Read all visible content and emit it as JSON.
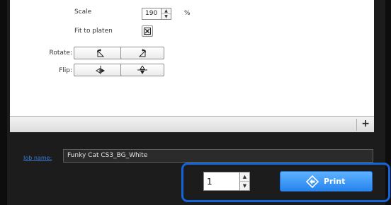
{
  "layout_panel": {
    "scale_label": "Scale",
    "scale_value": "190",
    "scale_unit": "%",
    "fit_label": "Fit to platen",
    "rotate_label": "Rotate:",
    "flip_label": "Flip:"
  },
  "list_bar": {
    "add_label": "+"
  },
  "job": {
    "label": "Job name:",
    "value": "Funky Cat CS3_BG_White"
  },
  "print_area": {
    "copies_value": "1",
    "print_label": "Print"
  },
  "colors": {
    "accent": "#1565d8",
    "print_button": "#2f8cf3"
  }
}
